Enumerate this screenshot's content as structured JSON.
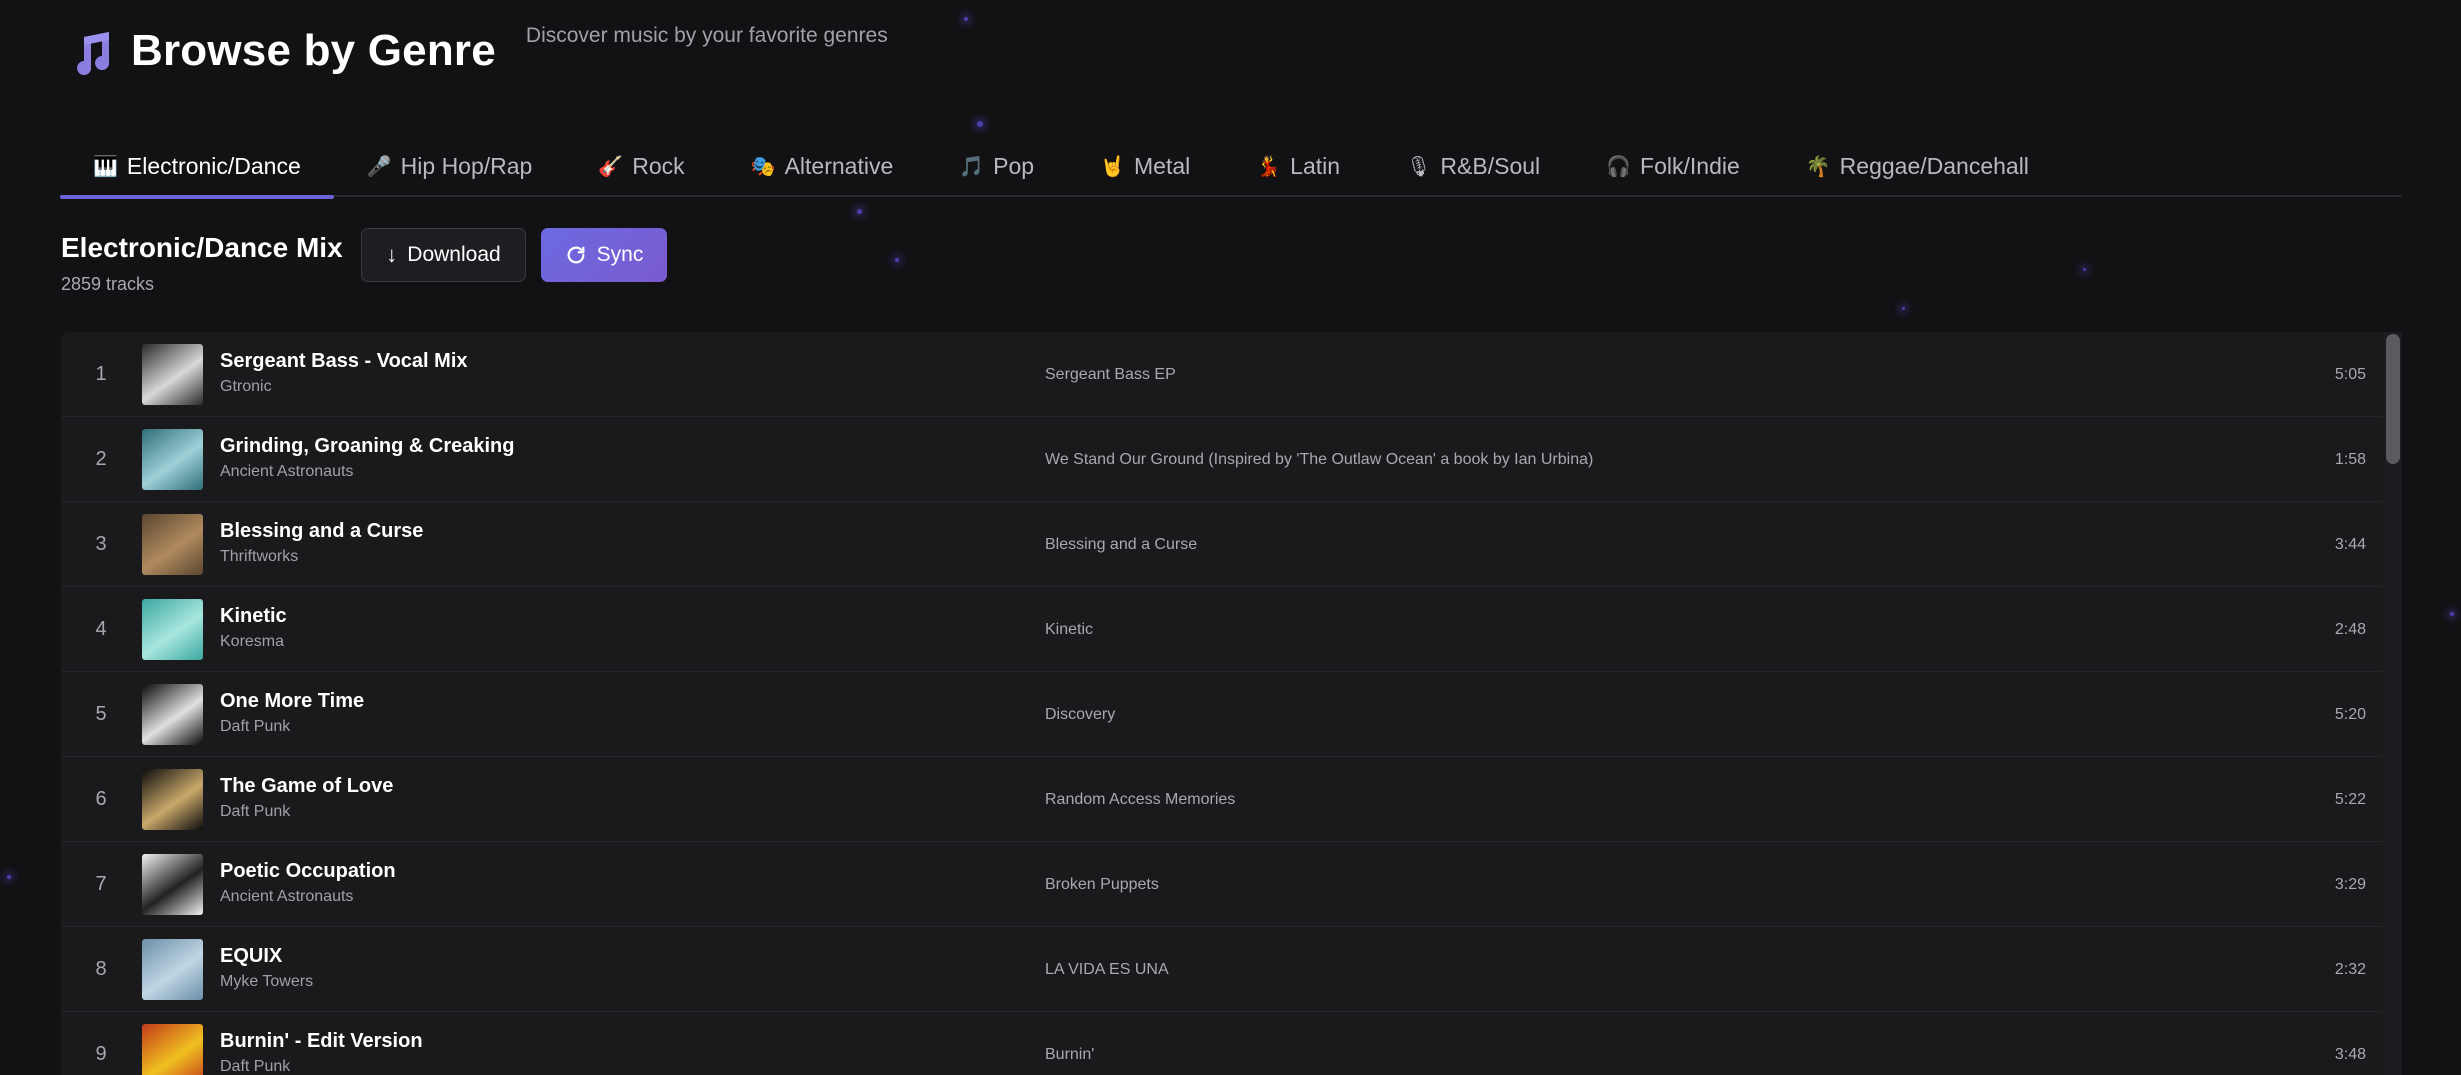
{
  "header": {
    "icon": "music-note-icon",
    "title": "Browse by Genre",
    "subtitle": "Discover music by your favorite genres"
  },
  "tabs": [
    {
      "label": "Electronic/Dance",
      "icon": "piano-icon",
      "glyph": "🎹",
      "active": true
    },
    {
      "label": "Hip Hop/Rap",
      "icon": "microphone-icon",
      "glyph": "🎤",
      "active": false
    },
    {
      "label": "Rock",
      "icon": "guitar-icon",
      "glyph": "🎸",
      "active": false
    },
    {
      "label": "Alternative",
      "icon": "theater-masks-icon",
      "glyph": "🎭",
      "active": false
    },
    {
      "label": "Pop",
      "icon": "music-note-icon",
      "glyph": "🎵",
      "active": false
    },
    {
      "label": "Metal",
      "icon": "rock-hand-icon",
      "glyph": "🤘",
      "active": false
    },
    {
      "label": "Latin",
      "icon": "dancer-icon",
      "glyph": "💃",
      "active": false
    },
    {
      "label": "R&B/Soul",
      "icon": "studio-microphone-icon",
      "glyph": "🎙",
      "active": false
    },
    {
      "label": "Folk/Indie",
      "icon": "headphones-icon",
      "glyph": "🎧",
      "active": false
    },
    {
      "label": "Reggae/Dancehall",
      "icon": "palm-tree-icon",
      "glyph": "🌴",
      "active": false
    }
  ],
  "mix": {
    "title": "Electronic/Dance Mix",
    "count": "2859 tracks",
    "download_label": "Download",
    "download_icon": "download-arrow-icon",
    "sync_label": "Sync",
    "sync_icon": "refresh-icon"
  },
  "tracks": [
    {
      "num": "1",
      "title": "Sergeant Bass - Vocal Mix",
      "artist": "Gtronic",
      "album": "Sergeant Bass EP",
      "duration": "5:05",
      "art_colors": [
        "#2a2a2a",
        "#d8d8d8"
      ]
    },
    {
      "num": "2",
      "title": "Grinding, Groaning & Creaking",
      "artist": "Ancient Astronauts",
      "album": "We Stand Our Ground (Inspired by 'The Outlaw Ocean' a book by Ian Urbina)",
      "duration": "1:58",
      "art_colors": [
        "#2f6e78",
        "#9fd0d8"
      ]
    },
    {
      "num": "3",
      "title": "Blessing and a Curse",
      "artist": "Thriftworks",
      "album": "Blessing and a Curse",
      "duration": "3:44",
      "art_colors": [
        "#5a4630",
        "#b08a5e"
      ]
    },
    {
      "num": "4",
      "title": "Kinetic",
      "artist": "Koresma",
      "album": "Kinetic",
      "duration": "2:48",
      "art_colors": [
        "#3aa8a0",
        "#a8e6df"
      ]
    },
    {
      "num": "5",
      "title": "One More Time",
      "artist": "Daft Punk",
      "album": "Discovery",
      "duration": "5:20",
      "art_colors": [
        "#0a0a0a",
        "#e0e0e0"
      ]
    },
    {
      "num": "6",
      "title": "The Game of Love",
      "artist": "Daft Punk",
      "album": "Random Access Memories",
      "duration": "5:22",
      "art_colors": [
        "#0c0c0c",
        "#c9a86a"
      ]
    },
    {
      "num": "7",
      "title": "Poetic Occupation",
      "artist": "Ancient Astronauts",
      "album": "Broken Puppets",
      "duration": "3:29",
      "art_colors": [
        "#f2f2f2",
        "#222222"
      ]
    },
    {
      "num": "8",
      "title": "EQUIX",
      "artist": "Myke Towers",
      "album": "LA VIDA ES UNA",
      "duration": "2:32",
      "art_colors": [
        "#6b8fa8",
        "#c0d6e4"
      ]
    },
    {
      "num": "9",
      "title": "Burnin' - Edit Version",
      "artist": "Daft Punk",
      "album": "Burnin'",
      "duration": "3:48",
      "art_colors": [
        "#c23a1a",
        "#f0c020"
      ]
    }
  ],
  "colors": {
    "background": "#121214",
    "accent": "#6c63d9",
    "panel": "#1a1a1d",
    "muted_text": "#a8a8b0"
  }
}
